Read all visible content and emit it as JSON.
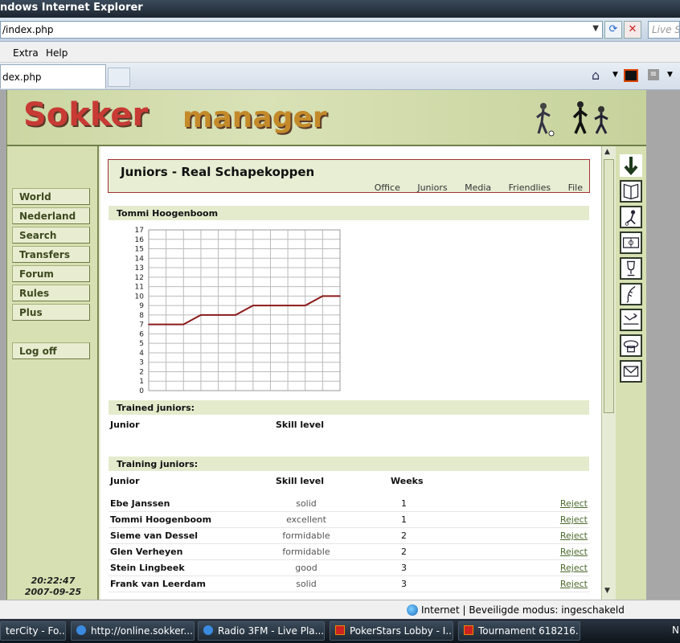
{
  "browser": {
    "title": "ndows Internet Explorer",
    "address": "/index.php",
    "search_placeholder": "Live Se",
    "menu": [
      "Extra",
      "Help"
    ],
    "tab_title": "dex.php"
  },
  "site": {
    "logo_part1": "Sokker",
    "logo_part2": "manager"
  },
  "nav": {
    "items": [
      "World",
      "Nederland",
      "Search",
      "Transfers",
      "Forum",
      "Rules",
      "Plus"
    ],
    "logoff": "Log off",
    "time": "20:22:47",
    "date": "2007-09-25"
  },
  "page": {
    "title": "Juniors - Real Schapekoppen",
    "tabs": [
      "Office",
      "Juniors",
      "Media",
      "Friendlies",
      "File"
    ]
  },
  "player_chart_title": "Tommi Hoogenboom",
  "chart_data": {
    "type": "line",
    "title": "Tommi Hoogenboom",
    "xlabel": "",
    "ylabel": "",
    "ylim": [
      0,
      17
    ],
    "yticks": [
      0,
      1,
      2,
      3,
      4,
      5,
      6,
      7,
      8,
      9,
      10,
      11,
      12,
      13,
      14,
      15,
      16,
      17
    ],
    "grid": true,
    "series": [
      {
        "color": "#8b1a1a",
        "x": [
          0,
          1,
          2,
          3,
          4,
          5,
          6,
          7,
          8,
          9,
          10,
          11
        ],
        "values": [
          7,
          7,
          7,
          8,
          8,
          8,
          9,
          9,
          9,
          9,
          10,
          10
        ]
      }
    ]
  },
  "trained": {
    "header": "Trained juniors:",
    "columns": [
      "Junior",
      "Skill level"
    ]
  },
  "training": {
    "header": "Training juniors:",
    "columns": [
      "Junior",
      "Skill level",
      "Weeks"
    ],
    "reject_label": "Reject",
    "rows": [
      {
        "name": "Ebe Janssen",
        "skill": "solid",
        "weeks": "1"
      },
      {
        "name": "Tommi Hoogenboom",
        "skill": "excellent",
        "weeks": "1"
      },
      {
        "name": "Sieme van Dessel",
        "skill": "formidable",
        "weeks": "2"
      },
      {
        "name": "Glen Verheyen",
        "skill": "formidable",
        "weeks": "2"
      },
      {
        "name": "Stein Lingbeek",
        "skill": "good",
        "weeks": "3"
      },
      {
        "name": "Frank van Leerdam",
        "skill": "solid",
        "weeks": "3"
      }
    ]
  },
  "statusbar": {
    "text": "Internet | Beveiligde modus: ingeschakeld"
  },
  "taskbar": {
    "items": [
      "terCity - Fo...",
      "http://online.sokker....",
      "Radio 3FM - Live Pla...",
      "PokerStars Lobby - I...",
      "Tournament 618216..."
    ],
    "tail": "N"
  }
}
